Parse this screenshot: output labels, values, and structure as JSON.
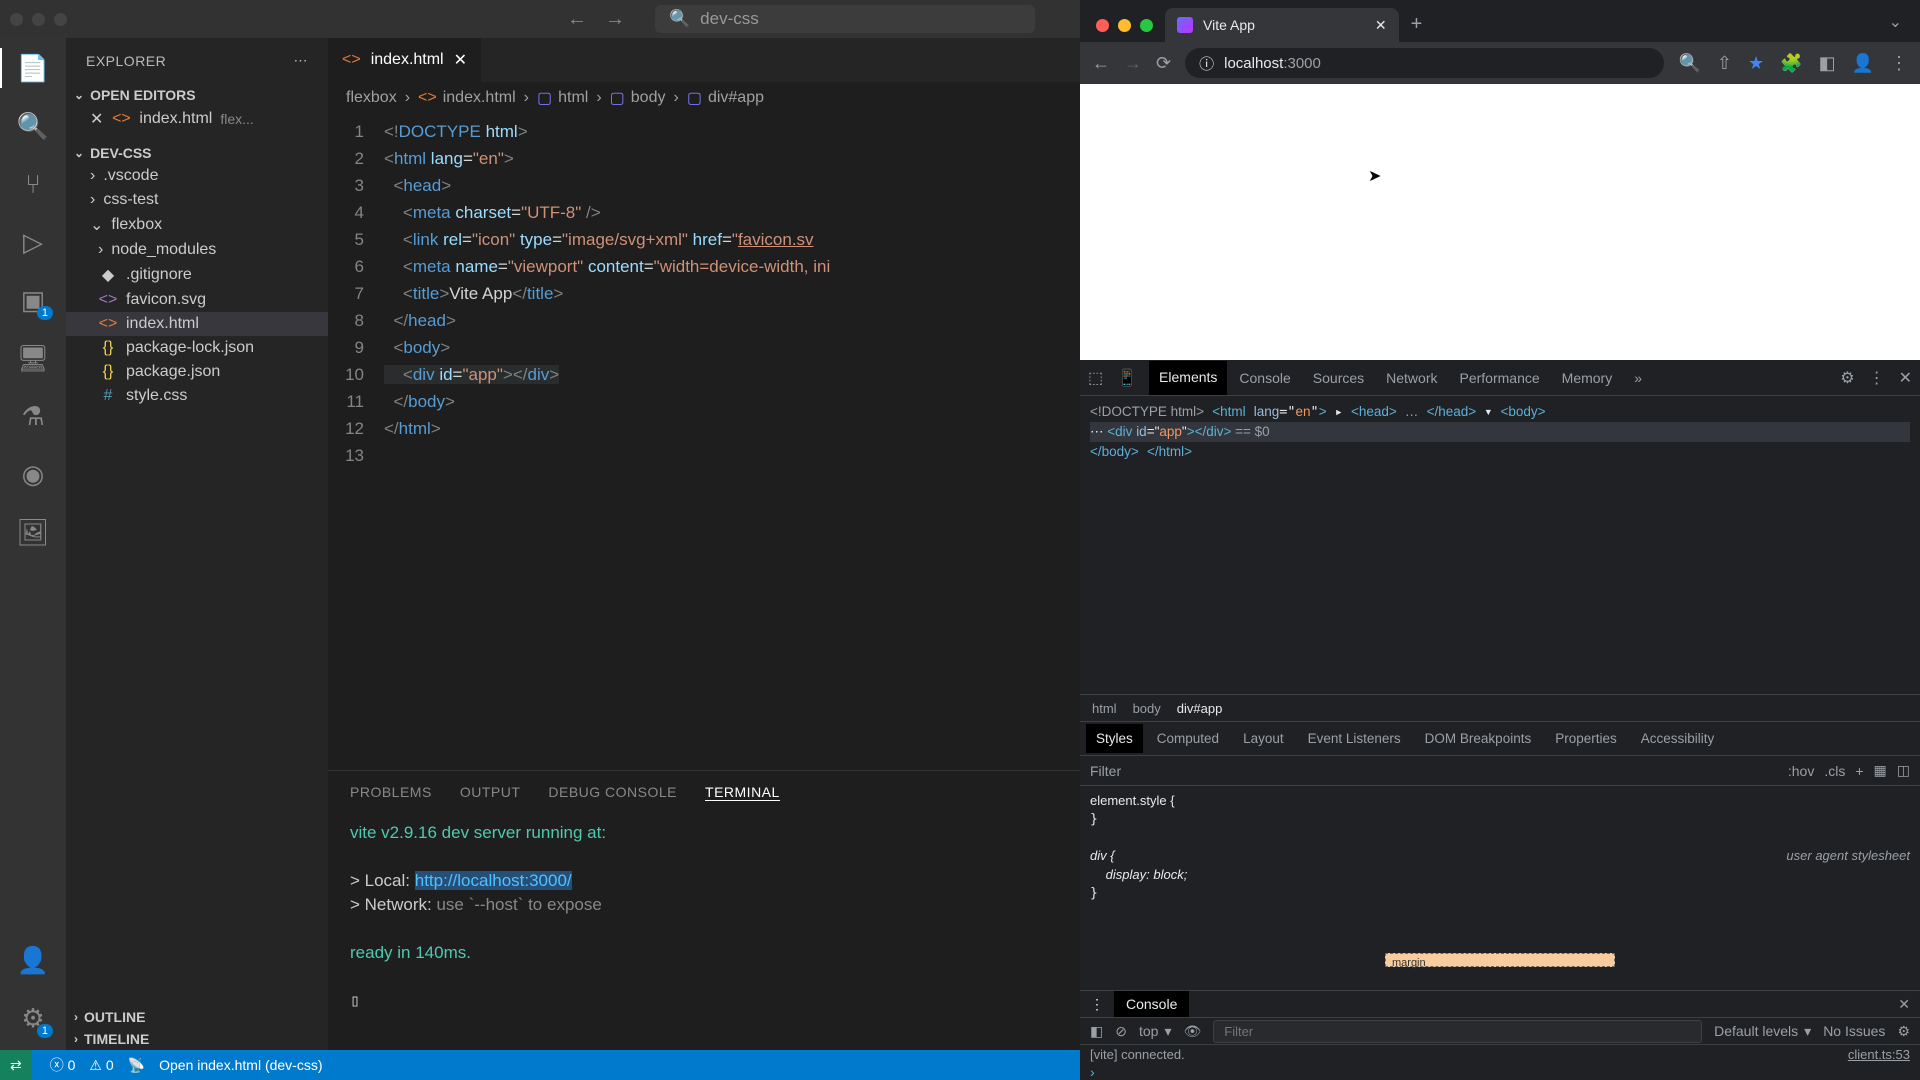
{
  "vscode": {
    "title_search": "dev-css",
    "explorer_label": "EXPLORER",
    "sections": {
      "open_editors": "OPEN EDITORS",
      "project": "DEV-CSS",
      "outline": "OUTLINE",
      "timeline": "TIMELINE"
    },
    "open_editor_file": "index.html",
    "open_editor_hint": "flex...",
    "tree": {
      "vscode_folder": ".vscode",
      "css_test": "css-test",
      "flexbox": "flexbox",
      "node_modules": "node_modules",
      "gitignore": ".gitignore",
      "favicon": "favicon.svg",
      "index": "index.html",
      "pkg_lock": "package-lock.json",
      "pkg": "package.json",
      "style": "style.css"
    },
    "tab_file": "index.html",
    "breadcrumbs": [
      "flexbox",
      "index.html",
      "html",
      "body",
      "div#app"
    ],
    "code_lines": {
      "l1": "<!DOCTYPE html>",
      "l2": "<html lang=\"en\">",
      "l3": "<head>",
      "l4": "<meta charset=\"UTF-8\" />",
      "l5": "<link rel=\"icon\" type=\"image/svg+xml\" href=\"favicon.sv",
      "l6": "<meta name=\"viewport\" content=\"width=device-width, ini",
      "l7": "<title>Vite App</title>",
      "l8": "</head>",
      "l9": "<body>",
      "l10": "<div id=\"app\"></div>",
      "l11": "</body>",
      "l12": "</html>"
    },
    "panel_tabs": [
      "PROBLEMS",
      "OUTPUT",
      "DEBUG CONSOLE",
      "TERMINAL"
    ],
    "terminal": {
      "line1": "vite v2.9.16 dev server running at:",
      "local_label": "> Local:   ",
      "local_url": "http://localhost:3000/",
      "network": "> Network: ",
      "network_hint": "use `--host` to expose",
      "ready": "ready in 140ms."
    },
    "status": {
      "errors": "0",
      "warnings": "0",
      "open_file": "Open index.html (dev-css)"
    },
    "ext_badge": "1"
  },
  "browser": {
    "tab_title": "Vite App",
    "url_host": "localhost",
    "url_port": ":3000",
    "devtools": {
      "tabs": [
        "Elements",
        "Console",
        "Sources",
        "Network",
        "Performance",
        "Memory"
      ],
      "dom": {
        "doctype": "<!DOCTYPE html>",
        "html_open": "<html lang=\"en\">",
        "head": "<head> … </head>",
        "body_open": "<body>",
        "app_div": "<div id=\"app\"></div>",
        "eq0": " == $0",
        "body_close": "</body>",
        "html_close": "</html>"
      },
      "crumbs": [
        "html",
        "body",
        "div#app"
      ],
      "styles_tabs": [
        "Styles",
        "Computed",
        "Layout",
        "Event Listeners",
        "DOM Breakpoints",
        "Properties",
        "Accessibility"
      ],
      "filter_placeholder": "Filter",
      "hov": ":hov",
      "cls": ".cls",
      "element_style": "element.style {",
      "div_rule": "div {",
      "display_prop": "display",
      "display_val": "block",
      "ua_sheet": "user agent stylesheet",
      "box_label": "margin",
      "console": {
        "label": "Console",
        "top": "top",
        "filter": "Filter",
        "levels": "Default levels",
        "no_issues": "No Issues",
        "msg": "[vite] connected.",
        "src": "client.ts:53"
      }
    }
  }
}
